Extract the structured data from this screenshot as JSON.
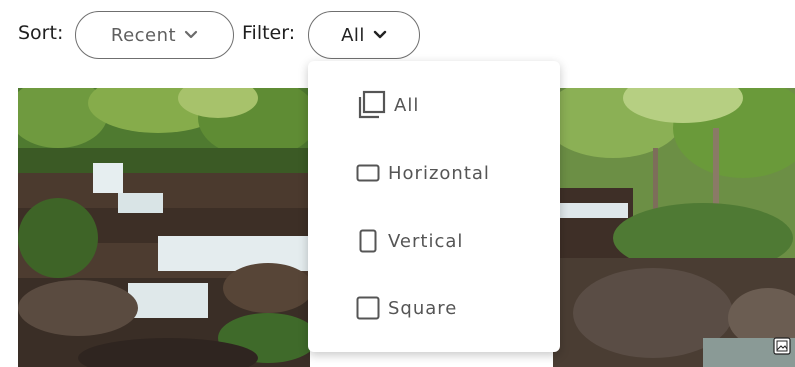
{
  "toolbar": {
    "sort_label": "Sort:",
    "sort_value": "Recent",
    "filter_label": "Filter:",
    "filter_value": "All"
  },
  "filter_menu": {
    "options": [
      {
        "label": "All",
        "icon": "stacked-squares-icon"
      },
      {
        "label": "Horizontal",
        "icon": "horizontal-rectangle-icon"
      },
      {
        "label": "Vertical",
        "icon": "vertical-rectangle-icon"
      },
      {
        "label": "Square",
        "icon": "square-icon"
      }
    ]
  },
  "photos": [
    {
      "icon": "waterfall-photo"
    },
    {
      "icon": "forest-stream-photo",
      "badge_icon": "image-icon"
    }
  ],
  "colors": {
    "pill_border": "#6f6f6f",
    "menu_text": "#555555",
    "forest": "#3d6b2a",
    "rock": "#4a3a30",
    "water": "#e8eef0"
  }
}
